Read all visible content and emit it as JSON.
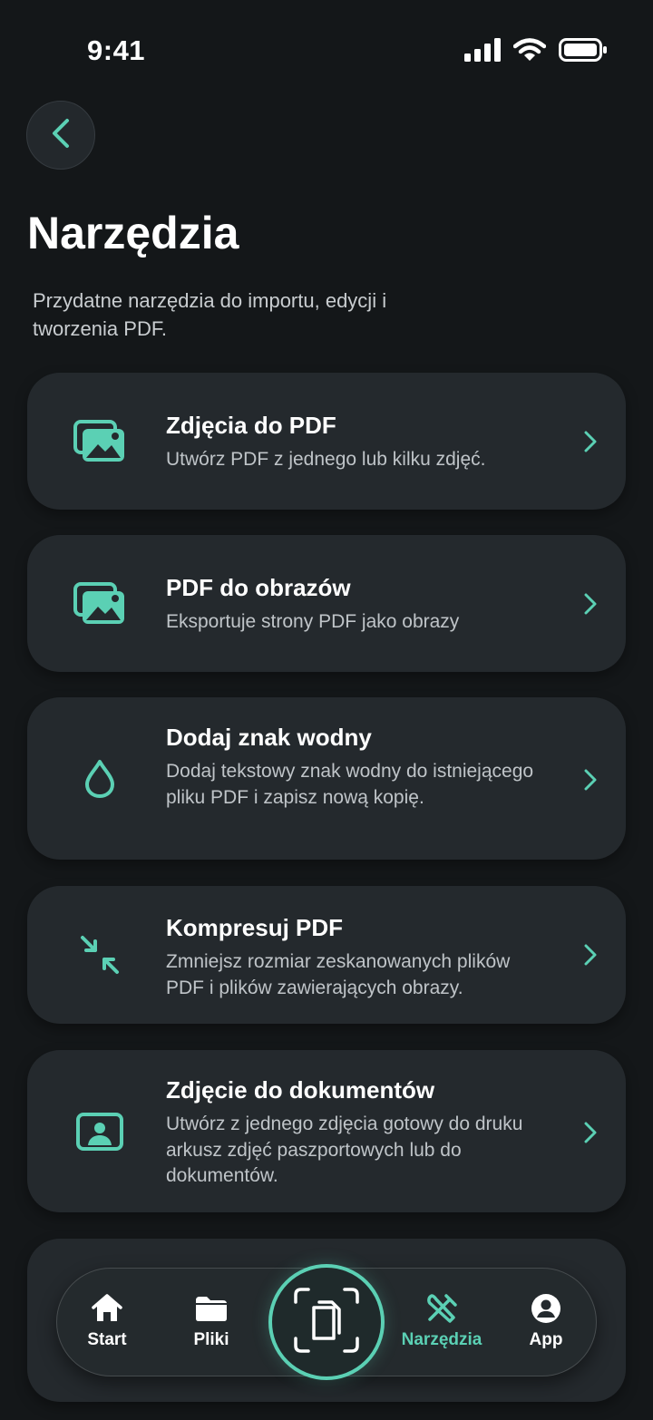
{
  "status": {
    "time": "9:41"
  },
  "header": {
    "title": "Narzędzia",
    "subtitle": "Przydatne narzędzia do importu, edycji i tworzenia PDF."
  },
  "tools": [
    {
      "icon": "images-icon",
      "title": "Zdjęcia do PDF",
      "desc": "Utwórz PDF z jednego lub kilku zdjęć."
    },
    {
      "icon": "images-icon",
      "title": "PDF do obrazów",
      "desc": "Eksportuje strony PDF jako obrazy"
    },
    {
      "icon": "water-drop-icon",
      "title": "Dodaj znak wodny",
      "desc": "Dodaj tekstowy znak wodny do istniejącego pliku PDF i zapisz nową kopię."
    },
    {
      "icon": "compress-icon",
      "title": "Kompresuj PDF",
      "desc": "Zmniejsz rozmiar zeskanowanych plików PDF i plików zawierających obrazy."
    },
    {
      "icon": "portrait-icon",
      "title": "Zdjęcie do dokumentów",
      "desc": "Utwórz z jednego zdjęcia gotowy do druku arkusz zdjęć paszportowych lub do dokumentów."
    }
  ],
  "nav": {
    "items": [
      {
        "label": "Start",
        "icon": "home-icon"
      },
      {
        "label": "Pliki",
        "icon": "folder-icon"
      },
      {
        "label": "Narzędzia",
        "icon": "tools-icon",
        "active": true
      },
      {
        "label": "App",
        "icon": "account-icon"
      }
    ],
    "scan_icon": "scan-document-icon"
  },
  "colors": {
    "accent": "#5bd0b4",
    "background": "#141719",
    "card": "#24292d"
  }
}
